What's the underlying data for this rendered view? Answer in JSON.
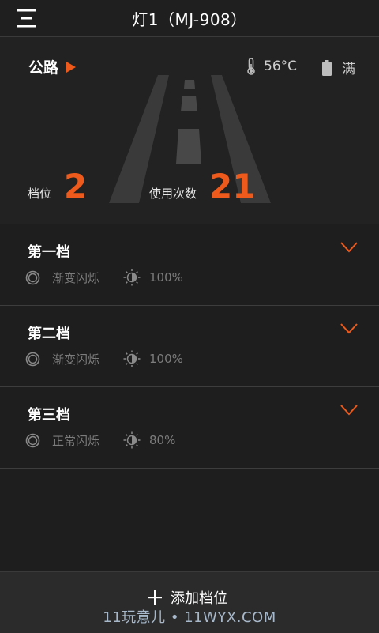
{
  "header": {
    "title": "灯1（MJ-908）",
    "menu_icon": "menu-icon"
  },
  "status": {
    "mode_label": "公路",
    "temperature": "56°C",
    "battery": "满",
    "gear_label": "档位",
    "gear_value": "2",
    "uses_label": "使用次数",
    "uses_value": "21"
  },
  "gears": [
    {
      "title": "第一档",
      "mode": "渐变闪烁",
      "brightness": "100%"
    },
    {
      "title": "第二档",
      "mode": "渐变闪烁",
      "brightness": "100%"
    },
    {
      "title": "第三档",
      "mode": "正常闪烁",
      "brightness": "80%"
    }
  ],
  "footer": {
    "add_label": "添加档位",
    "watermark": "11玩意儿 • 11WYX.COM"
  },
  "colors": {
    "accent": "#ee5a1b",
    "background": "#1e1e1e",
    "muted": "#7c7c7c"
  }
}
